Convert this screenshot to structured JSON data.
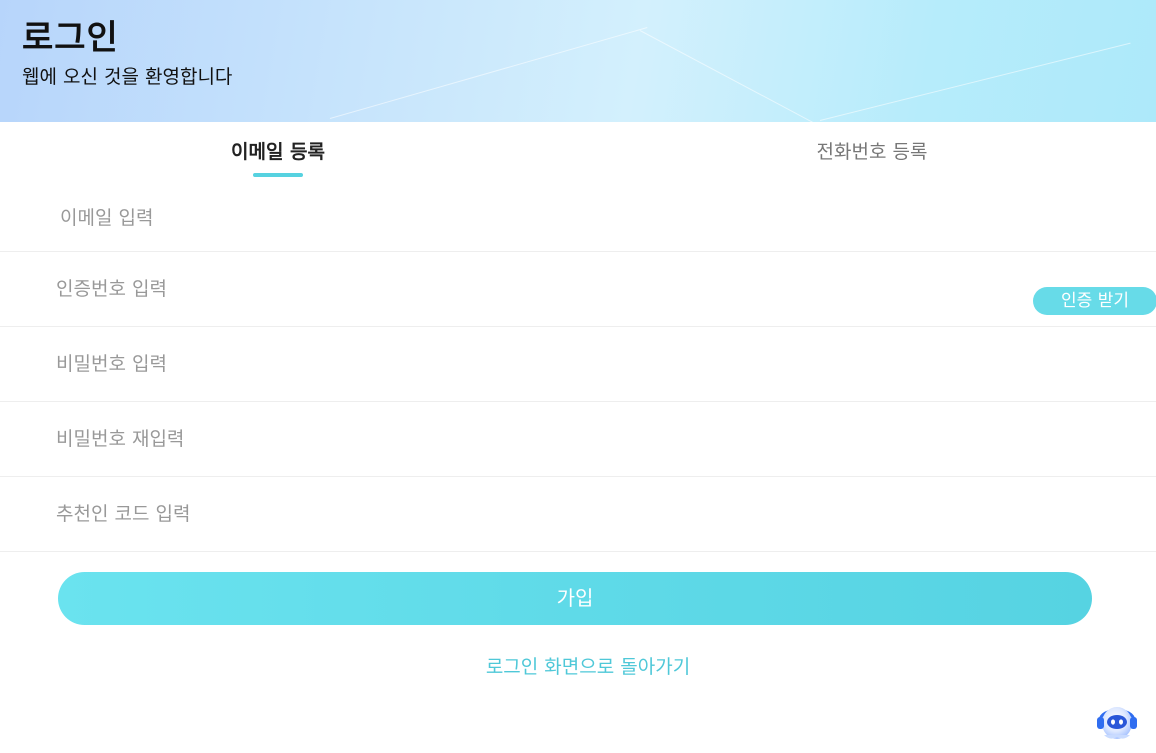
{
  "header": {
    "title": "로그인",
    "subtitle": "웹에 오신 것을 환영합니다"
  },
  "tabs": [
    {
      "label": "이메일 등록",
      "active": true
    },
    {
      "label": "전화번호 등록",
      "active": false
    }
  ],
  "form": {
    "email_placeholder": "이메일 입력",
    "code_placeholder": "인증번호 입력",
    "password_placeholder": "비밀번호 입력",
    "password_confirm_placeholder": "비밀번호 재입력",
    "referral_placeholder": "추천인 코드 입력",
    "get_code_label": "인증 받기",
    "submit_label": "가입"
  },
  "back_link_label": "로그인 화면으로 돌아가기",
  "assistant_icon": "chat-assistant-icon",
  "colors": {
    "accent": "#5fd9e6",
    "link": "#4fc8d8",
    "header_gradient_start": "#b7d5fb",
    "header_gradient_end": "#ade9fa"
  }
}
